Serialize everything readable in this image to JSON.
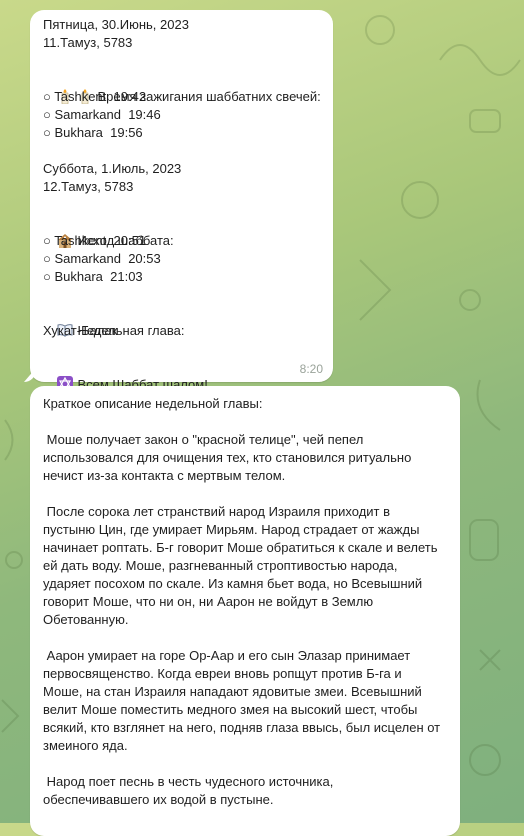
{
  "message1": {
    "date_fri": "Пятница, 30.Июнь, 2023",
    "hebdate_fri": "11.Тамуз, 5783",
    "candles_title": "Время зажигания шаббатних свечей:",
    "candles": [
      {
        "city": "Tashkent",
        "time": "19:42"
      },
      {
        "city": "Samarkand",
        "time": "19:46"
      },
      {
        "city": "Bukhara",
        "time": "19:56"
      }
    ],
    "date_sat": "Суббота, 1.Июль, 2023",
    "hebdate_sat": "12.Тамуз, 5783",
    "exit_title": "Исход шаббата:",
    "exits": [
      {
        "city": "Tashkent",
        "time": "20:51"
      },
      {
        "city": "Samarkand",
        "time": "20:53"
      },
      {
        "city": "Bukhara",
        "time": "21:03"
      }
    ],
    "parasha_title": "Недельная глава:",
    "parasha_name": "Хукат-Балак",
    "greeting": "Всем Шаббат шалом!",
    "time": "8:20"
  },
  "message2": {
    "heading": "Краткое описание недельной главы:",
    "paragraphs": [
      " Моше получает закон о \"красной телице\", чей пепел использовался для очищения тех, кто становился ритуально нечист из-за контакта с мертвым телом.",
      " После сорока лет странствий народ Израиля приходит в пустыню Цин, где умирает Мирьям. Народ страдает от жажды начинает роптать. Б-г говорит Моше обратиться к скале и велеть ей дать воду. Моше, разгневанный строптивостью народа, ударяет посохом по скале. Из камня бьет вода, но Всевышний говорит Моше, что ни он, ни Аарон не войдут в Землю Обетованную.",
      " Аарон умирает на горе Ор-Аар и его сын Элазар принимает первосвященство. Когда евреи вновь ропщут против Б-га и Моше, на стан Израиля нападают ядовитые змеи. Всевышний велит Моше поместить медного змея на высокий шест, чтобы всякий, кто взглянет на него, подняв глаза ввысь, был исцелен от змеиного яда.",
      " Народ поет песнь в честь чудесного источника, обеспечивавшего их водой в пустыне."
    ]
  }
}
